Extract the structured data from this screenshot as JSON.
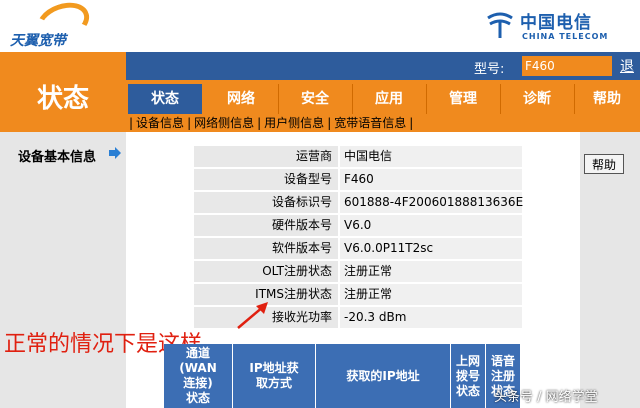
{
  "header": {
    "brand_left": "天翼宽带",
    "brand_right_cn": "中国电信",
    "brand_right_en": "CHINA TELECOM"
  },
  "page": {
    "section_title": "状态"
  },
  "model": {
    "label": "型号:",
    "value": "F460",
    "exit_label": "退"
  },
  "tabs": [
    {
      "label": "状态"
    },
    {
      "label": "网络"
    },
    {
      "label": "安全"
    },
    {
      "label": "应用"
    },
    {
      "label": "管理"
    },
    {
      "label": "诊断"
    },
    {
      "label": "帮助"
    }
  ],
  "submenu": [
    "设备信息",
    "网络侧信息",
    "用户侧信息",
    "宽带语音信息"
  ],
  "left_nav": {
    "item": "设备基本信息"
  },
  "help_button": "帮助",
  "device_info": [
    {
      "key": "运营商",
      "value": "中国电信"
    },
    {
      "key": "设备型号",
      "value": "F460"
    },
    {
      "key": "设备标识号",
      "value": "601888-4F20060188813636E"
    },
    {
      "key": "硬件版本号",
      "value": "V6.0"
    },
    {
      "key": "软件版本号",
      "value": "V6.0.0P11T2sc"
    },
    {
      "key": "OLT注册状态",
      "value": "注册正常"
    },
    {
      "key": "ITMS注册状态",
      "value": "注册正常"
    },
    {
      "key": "接收光功率",
      "value": "-20.3 dBm"
    }
  ],
  "annotation": "正常的情况下是这样",
  "wan_table": {
    "headers": [
      "通道\n(WAN\n连接)\n状态",
      "IP地址获\n取方式",
      "获取的IP地址",
      "上网\n拨号\n状态",
      "语音\n注册\n状态"
    ]
  },
  "watermark": "头条号 / 网络学堂",
  "colors": {
    "orange": "#f08a1e",
    "blue": "#2e5c9c",
    "annotation_red": "#e02010"
  }
}
